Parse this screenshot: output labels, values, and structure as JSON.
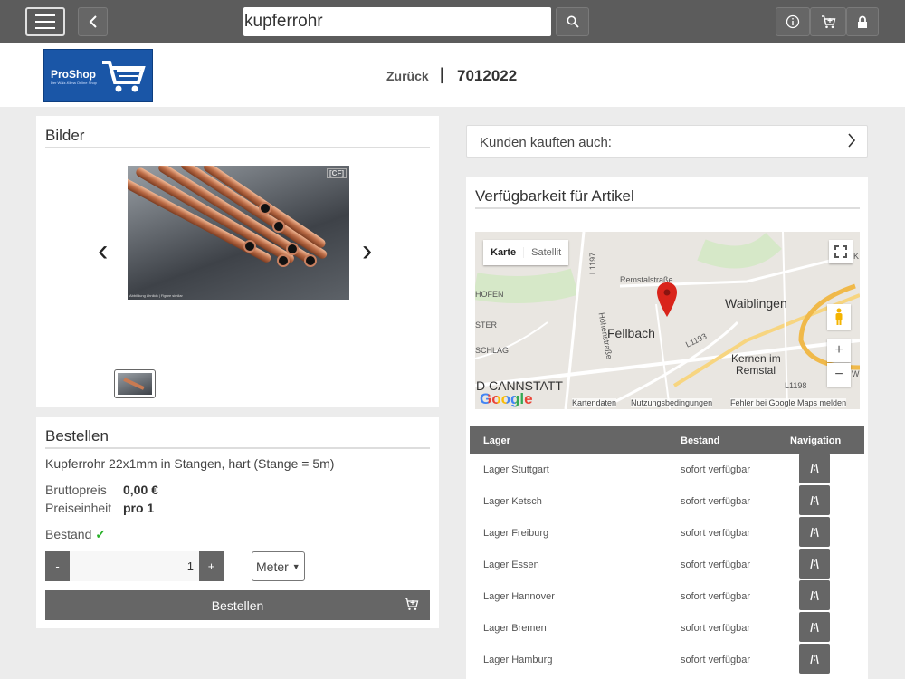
{
  "search": {
    "value": "kupferrohr"
  },
  "header": {
    "logo_text": "ProShop",
    "logo_subtitle": "Der Wälz-Klima Online Shop",
    "back_label": "Zurück",
    "separator": "|",
    "article_number": "7012022"
  },
  "bilder": {
    "title": "Bilder",
    "image_badge": "[CF]",
    "image_caption": "Abbildung ähnlich | Figure similar"
  },
  "bestellen": {
    "title": "Bestellen",
    "product_name": "Kupferrohr 22x1mm in Stangen, hart (Stange = 5m)",
    "bruttopreis_label": "Bruttopreis",
    "bruttopreis_value": "0,00 €",
    "preiseinheit_label": "Preiseinheit",
    "preiseinheit_value": "pro 1",
    "bestand_label": "Bestand",
    "bestand_check": "✓",
    "minus": "-",
    "plus": "+",
    "quantity": "1",
    "unit": "Meter",
    "order_button": "Bestellen"
  },
  "kunden": {
    "label": "Kunden kauften auch:"
  },
  "verfuegbarkeit": {
    "title": "Verfügbarkeit für Artikel",
    "map": {
      "type_map": "Karte",
      "type_satellite": "Satellit",
      "labels": {
        "fellbach": "Fellbach",
        "waiblingen": "Waiblingen",
        "kernen": "Kernen im",
        "kernen2": "Remstal",
        "cannstatt": "D CANNSTATT",
        "hofen": "HOFEN",
        "ster": "STER",
        "schlag": "SCHLAG",
        "remstal_str": "Remstalstraße",
        "hoehen_str": "Höhenstraße",
        "l1197": "L1197",
        "l1193": "L1193",
        "l1198": "L1198",
        "k": "K",
        "w": "W"
      },
      "google": "Google",
      "footer_data": "Kartendaten",
      "footer_terms": "Nutzungsbedingungen",
      "footer_report": "Fehler bei Google Maps melden"
    },
    "table": {
      "headers": [
        "Lager",
        "Bestand",
        "Navigation"
      ],
      "rows": [
        {
          "lager": "Lager Stuttgart",
          "bestand": "sofort verfügbar"
        },
        {
          "lager": "Lager Ketsch",
          "bestand": "sofort verfügbar"
        },
        {
          "lager": "Lager Freiburg",
          "bestand": "sofort verfügbar"
        },
        {
          "lager": "Lager Essen",
          "bestand": "sofort verfügbar"
        },
        {
          "lager": "Lager Hannover",
          "bestand": "sofort verfügbar"
        },
        {
          "lager": "Lager Bremen",
          "bestand": "sofort verfügbar"
        },
        {
          "lager": "Lager Hamburg",
          "bestand": "sofort verfügbar"
        }
      ]
    }
  },
  "colors": {
    "topbar": "#5c5c5c",
    "button": "#666666",
    "logo": "#1a56a7",
    "check": "#28b028"
  }
}
